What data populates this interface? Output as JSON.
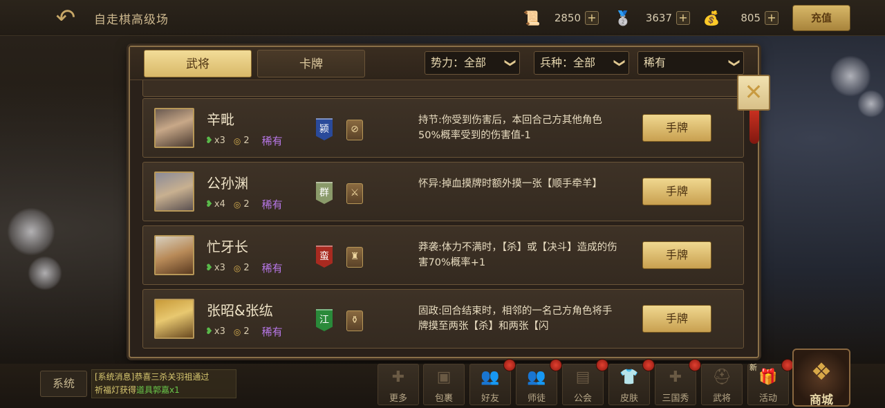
{
  "header": {
    "title": "自走棋高级场",
    "currencies": [
      {
        "icon": "scroll-currency-icon",
        "glyph": "📜",
        "value": "2850"
      },
      {
        "icon": "silver-ingot-icon",
        "glyph": "🥈",
        "value": "3637"
      },
      {
        "icon": "gold-ingot-icon",
        "glyph": "💰",
        "value": "805"
      }
    ],
    "plus": "+",
    "recharge_label": "充值"
  },
  "panel": {
    "tabs": [
      {
        "label": "武将",
        "active": true
      },
      {
        "label": "卡牌",
        "active": false
      }
    ],
    "filters": {
      "faction": "势力：全部",
      "troop": "兵种：全部",
      "rarity": "稀有"
    },
    "chevron": "❯",
    "close_glyph": "✕",
    "heroes": [
      {
        "name": "辛毗",
        "hp": "x3",
        "cost": "2",
        "rarity": "稀有",
        "faction": "颍",
        "faction_color": "#2a4a9a",
        "class_glyph": "⊘",
        "skill": "持节:你受到伤害后，本回合己方其他角色50%概率受到的伤害值-1",
        "button": "手牌"
      },
      {
        "name": "公孙渊",
        "hp": "x4",
        "cost": "2",
        "rarity": "稀有",
        "faction": "群",
        "faction_color": "#8a9a6a",
        "class_glyph": "⚔",
        "skill": "怀异:掉血摸牌时额外摸一张【顺手牵羊】",
        "button": "手牌"
      },
      {
        "name": "忙牙长",
        "hp": "x3",
        "cost": "2",
        "rarity": "稀有",
        "faction": "蛮",
        "faction_color": "#a82a20",
        "class_glyph": "♜",
        "skill": "莽袭:体力不满时，【杀】或【决斗】造成的伤害70%概率+1",
        "button": "手牌"
      },
      {
        "name": "张昭&张纮",
        "hp": "x3",
        "cost": "2",
        "rarity": "稀有",
        "faction": "江",
        "faction_color": "#2a8a3a",
        "class_glyph": "⚱",
        "skill": "固政:回合结束时，相邻的一名己方角色将手牌摸至两张【杀】和两张【闪",
        "button": "手牌"
      }
    ]
  },
  "bottom": {
    "system_label": "系统",
    "sys_msg_line1": "[系统消息]恭喜三杀关羽祖通过",
    "sys_msg_line2a": "祈福灯获得",
    "sys_msg_line2b": "道具郭嘉x1",
    "nav": [
      {
        "label": "更多",
        "icon": "plus-icon",
        "glyph": "✚",
        "dot": false
      },
      {
        "label": "包裹",
        "icon": "bag-icon",
        "glyph": "▣",
        "dot": false
      },
      {
        "label": "好友",
        "icon": "friends-icon",
        "glyph": "👥",
        "dot": true
      },
      {
        "label": "师徒",
        "icon": "mentor-icon",
        "glyph": "👥",
        "dot": true
      },
      {
        "label": "公会",
        "icon": "guild-icon",
        "glyph": "▤",
        "dot": true
      },
      {
        "label": "皮肤",
        "icon": "skin-icon",
        "glyph": "👕",
        "dot": true
      },
      {
        "label": "三国秀",
        "icon": "show-icon",
        "glyph": "✚",
        "dot": true
      },
      {
        "label": "武将",
        "icon": "general-icon",
        "glyph": "⛑",
        "dot": false
      },
      {
        "label": "活动",
        "icon": "gift-icon",
        "glyph": "🎁",
        "dot": true
      }
    ],
    "new_label": "新",
    "shop_label": "商城"
  }
}
